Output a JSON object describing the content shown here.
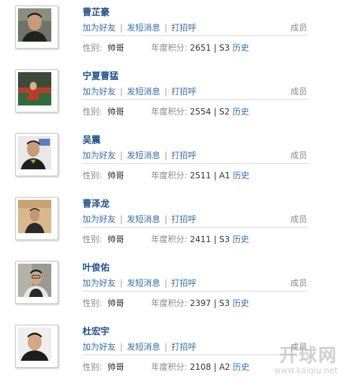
{
  "labels": {
    "add_friend": "加为好友",
    "send_message": "发短消息",
    "greet": "打招呼",
    "role": "成员",
    "gender_label": "性别:",
    "score_label": "年度积分:",
    "history": "历史",
    "pipe": "|"
  },
  "members": [
    {
      "name": "曹芷豪",
      "gender": "帅哥",
      "score": "2651",
      "level": "S3"
    },
    {
      "name": "宁夏曹猛",
      "gender": "帅哥",
      "score": "2554",
      "level": "S2"
    },
    {
      "name": "吴震",
      "gender": "帅哥",
      "score": "2511",
      "level": "A1"
    },
    {
      "name": "曹泽龙",
      "gender": "帅哥",
      "score": "2411",
      "level": "S3"
    },
    {
      "name": "叶俊佑",
      "gender": "帅哥",
      "score": "2397",
      "level": "S3"
    },
    {
      "name": "杜宏宇",
      "gender": "帅哥",
      "score": "2108",
      "level": "A2"
    }
  ],
  "watermark": {
    "text": "开球网",
    "url": "www.kaiqiu.net"
  }
}
